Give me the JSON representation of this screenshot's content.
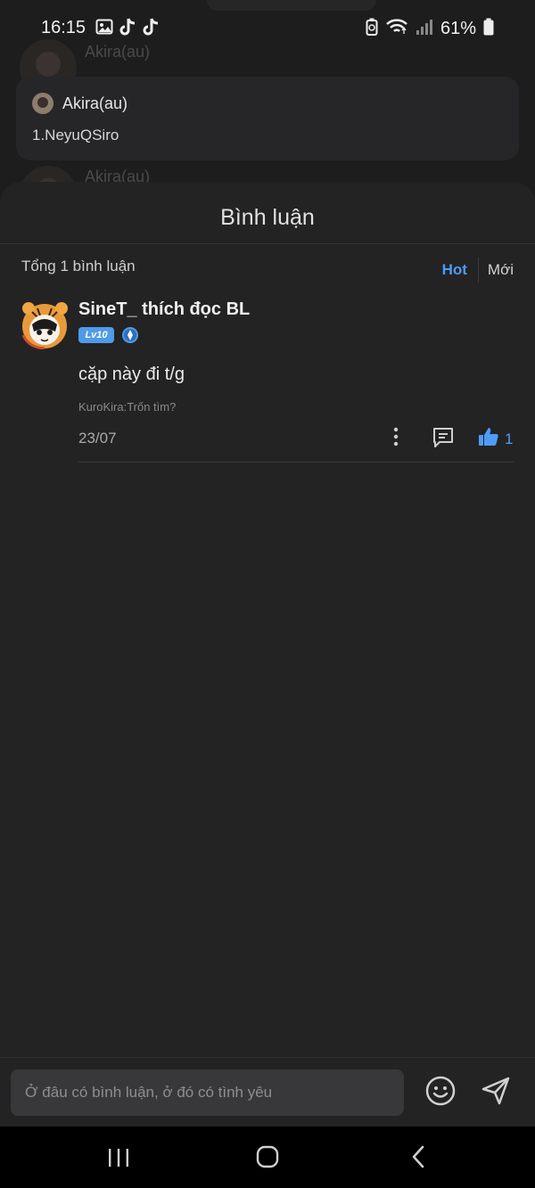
{
  "status_bar": {
    "time": "16:15",
    "battery": "61%",
    "left_icons": [
      "gallery-icon",
      "tiktok-icon",
      "tiktok-icon"
    ],
    "right_icons": [
      "battery-saver-icon",
      "wifi-icon",
      "signal-icon",
      "battery-icon"
    ]
  },
  "background": {
    "author_name_top": "Akira(au)",
    "author_name_bottom": "Akira(au)",
    "quote_card": {
      "author": "Akira(au)",
      "text": "1.NeyuQSiro"
    }
  },
  "sheet": {
    "title": "Bình luận",
    "total": "Tổng 1 bình luận",
    "sort": {
      "hot": "Hot",
      "new": "Mới",
      "active": "Hot"
    },
    "comments": [
      {
        "username": "SineT_ thích đọc BL",
        "level": "Lv10",
        "text": "cặp này đi t/g",
        "reference": "KuroKira:Trốn tìm?",
        "date": "23/07",
        "likes": "1"
      }
    ]
  },
  "composer": {
    "placeholder": "Ở đâu có bình luận, ở đó có tình yêu"
  },
  "colors": {
    "accent": "#4e9cf5",
    "sheet_bg": "#232324",
    "badge": "#4f9be8"
  }
}
